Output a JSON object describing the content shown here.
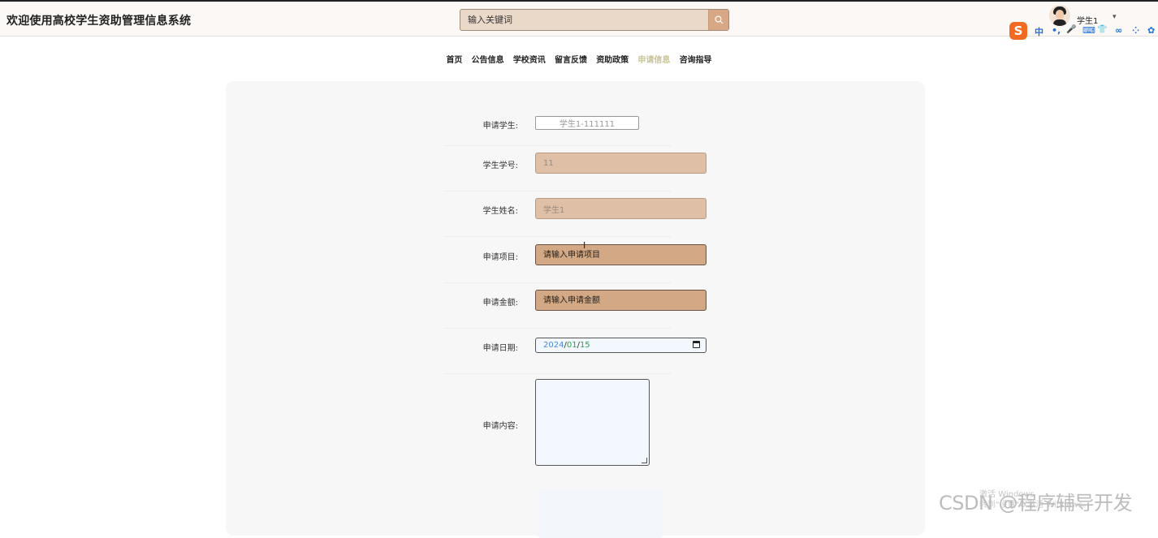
{
  "header": {
    "title": "欢迎使用高校学生资助管理信息系统",
    "search_placeholder": "输入关键词",
    "username": "学生1",
    "user_caret": "▾"
  },
  "ime": {
    "logo": "S",
    "items": [
      "中",
      "•,",
      "🎤",
      "⌨",
      "👕",
      "∞",
      "⁘",
      "✿"
    ]
  },
  "nav": {
    "items": [
      "首页",
      "公告信息",
      "学校资讯",
      "留言反馈",
      "资助政策",
      "申请信息",
      "咨询指导"
    ],
    "active_index": 5
  },
  "form": {
    "student_label": "申请学生:",
    "student_value": "学生1-111111",
    "student_no_label": "学生学号:",
    "student_no_value": "11",
    "student_name_label": "学生姓名:",
    "student_name_value": "学生1",
    "project_label": "申请项目:",
    "project_placeholder": "请输入申请项目",
    "amount_label": "申请金额:",
    "amount_placeholder": "请输入申请金额",
    "date_label": "申请日期:",
    "date_year": "2024",
    "date_month": "01",
    "date_day": "15",
    "date_sep": "/",
    "content_label": "申请内容:"
  },
  "overlay": {
    "watermark": "CSDN @程序辅导开发",
    "activate_line1": "激活 Windows",
    "activate_line2": "转到\"设置\"以激活 Windows。"
  },
  "colors": {
    "accent_search_button": "#d8a886",
    "readonly_field": "#dfbfa6",
    "editable_field": "#d3a884",
    "nav_active": "#c8c396"
  }
}
